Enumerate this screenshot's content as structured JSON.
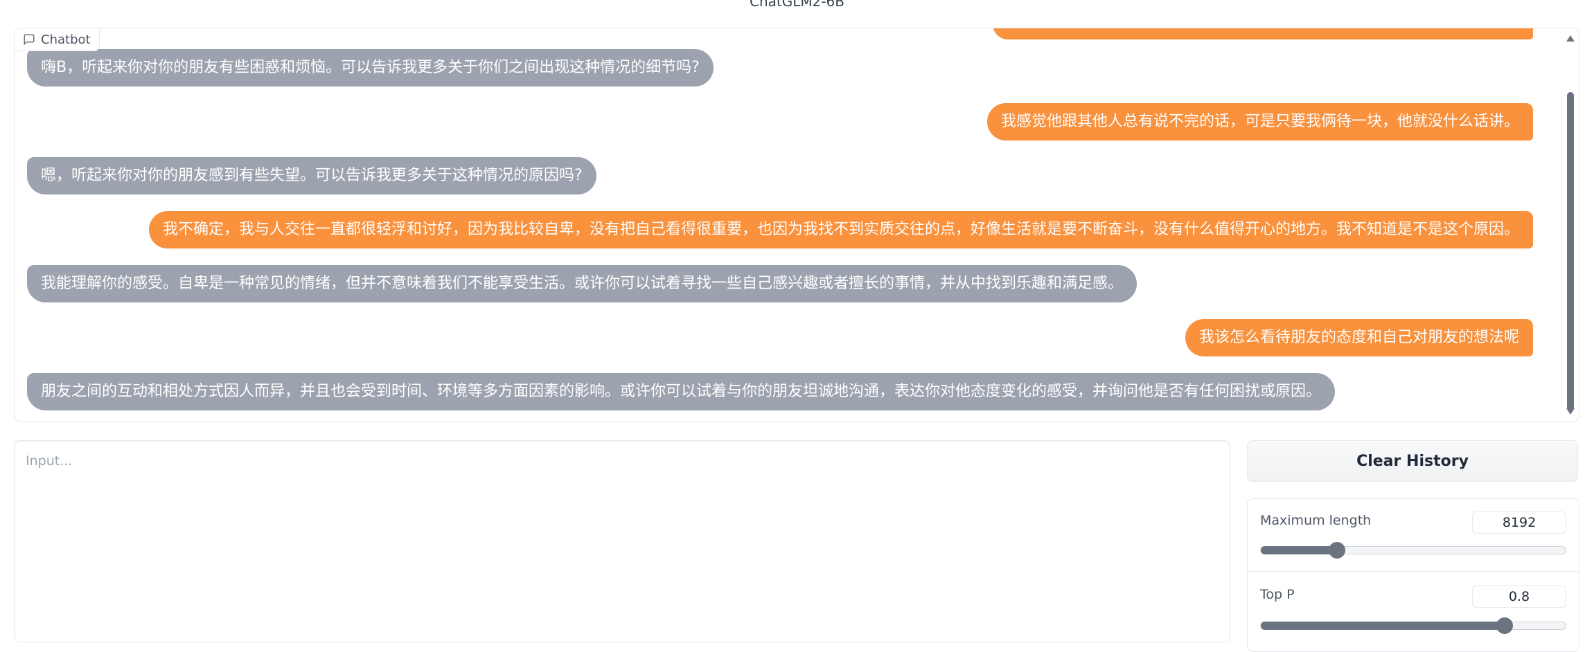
{
  "app": {
    "title": "ChatGLM2-6B"
  },
  "chatbot": {
    "label": "Chatbot",
    "messages": [
      {
        "role": "bot",
        "text": "嗨B，听起来你对你的朋友有些困惑和烦恼。可以告诉我更多关于你们之间出现这种情况的细节吗?"
      },
      {
        "role": "user",
        "text": "我感觉他跟其他人总有说不完的话，可是只要我俩待一块，他就没什么话讲。"
      },
      {
        "role": "bot",
        "text": "嗯，听起来你对你的朋友感到有些失望。可以告诉我更多关于这种情况的原因吗?"
      },
      {
        "role": "user",
        "text": "我不确定，我与人交往一直都很轻浮和讨好，因为我比较自卑，没有把自己看得很重要，也因为我找不到实质交往的点，好像生活就是要不断奋斗，没有什么值得开心的地方。我不知道是不是这个原因。"
      },
      {
        "role": "bot",
        "text": "我能理解你的感受。自卑是一种常见的情绪，但并不意味着我们不能享受生活。或许你可以试着寻找一些自己感兴趣或者擅长的事情，并从中找到乐趣和满足感。"
      },
      {
        "role": "user",
        "text": "我该怎么看待朋友的态度和自己对朋友的想法呢"
      },
      {
        "role": "bot",
        "text": "朋友之间的互动和相处方式因人而异，并且也会受到时间、环境等多方面因素的影响。或许你可以试着与你的朋友坦诚地沟通，表达你对他态度变化的感受，并询问他是否有任何困扰或原因。"
      }
    ]
  },
  "input": {
    "placeholder": "Input...",
    "value": ""
  },
  "buttons": {
    "clear_history": "Clear History"
  },
  "settings": {
    "max_length": {
      "label": "Maximum length",
      "value": "8192",
      "fraction": 0.25
    },
    "top_p": {
      "label": "Top P",
      "value": "0.8",
      "fraction": 0.8
    }
  },
  "colors": {
    "user_bubble": "#f9913d",
    "bot_bubble": "#9ca3af",
    "slider": "#6b7280"
  }
}
